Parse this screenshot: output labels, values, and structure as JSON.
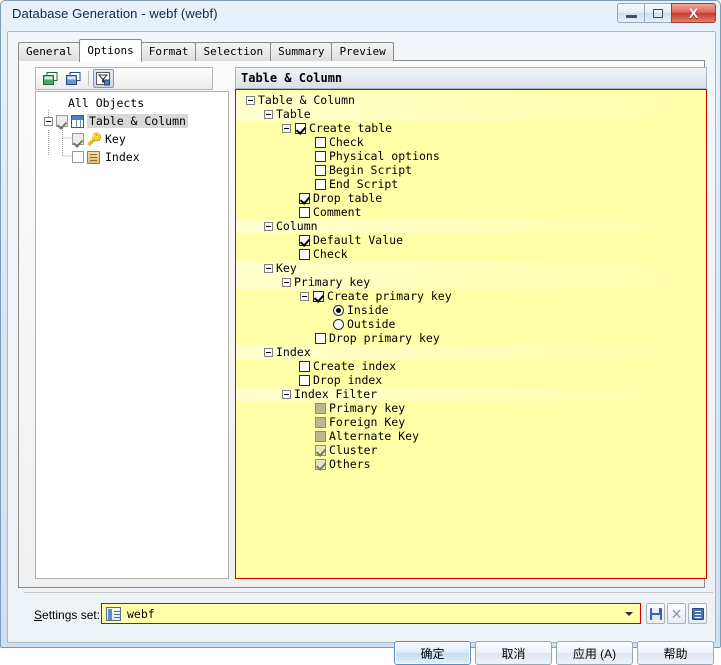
{
  "window": {
    "title": "Database Generation - webf (webf)",
    "controls": {
      "minimize": "Minimize",
      "maximize": "Maximize",
      "close": "X"
    }
  },
  "tabs": [
    {
      "label": "General",
      "active": false
    },
    {
      "label": "Options",
      "active": true
    },
    {
      "label": "Format",
      "active": false
    },
    {
      "label": "Selection",
      "active": false
    },
    {
      "label": "Summary",
      "active": false
    },
    {
      "label": "Preview",
      "active": false
    }
  ],
  "left_panel": {
    "toolbar": {
      "expand_all": "expand-all",
      "collapse_all": "collapse-all",
      "filter": "filter-selection"
    },
    "root_label": "All Objects",
    "items": [
      {
        "label": "Table & Column",
        "checked": true,
        "selected": true,
        "icon": "table-icon",
        "level": 0
      },
      {
        "label": "Key",
        "checked": true,
        "selected": false,
        "icon": "key-icon",
        "level": 1
      },
      {
        "label": "Index",
        "checked": false,
        "selected": false,
        "icon": "index-icon",
        "level": 1
      }
    ]
  },
  "right_panel": {
    "header": "Table & Column",
    "nodes": [
      {
        "label": "Table & Column",
        "indent": 0,
        "control": "expander",
        "expanded": true,
        "group": true
      },
      {
        "label": "Table",
        "indent": 1,
        "control": "expander",
        "expanded": true,
        "group": true
      },
      {
        "label": "Create table",
        "indent": 2,
        "control": "checkbox-expander",
        "expanded": true,
        "checked": true
      },
      {
        "label": "Check",
        "indent": 4,
        "control": "checkbox",
        "checked": false
      },
      {
        "label": "Physical options",
        "indent": 4,
        "control": "checkbox",
        "checked": false
      },
      {
        "label": "Begin Script",
        "indent": 4,
        "control": "checkbox",
        "checked": false
      },
      {
        "label": "End Script",
        "indent": 4,
        "control": "checkbox",
        "checked": false
      },
      {
        "label": "Drop table",
        "indent": 3,
        "control": "checkbox",
        "checked": true
      },
      {
        "label": "Comment",
        "indent": 3,
        "control": "checkbox",
        "checked": false
      },
      {
        "label": "Column",
        "indent": 1,
        "control": "expander",
        "expanded": true,
        "group": true
      },
      {
        "label": "Default Value",
        "indent": 3,
        "control": "checkbox",
        "checked": true
      },
      {
        "label": "Check",
        "indent": 3,
        "control": "checkbox",
        "checked": false
      },
      {
        "label": "Key",
        "indent": 1,
        "control": "expander",
        "expanded": true,
        "group": true
      },
      {
        "label": "Primary key",
        "indent": 2,
        "control": "expander",
        "expanded": true,
        "group": true
      },
      {
        "label": "Create primary key",
        "indent": 3,
        "control": "checkbox-expander",
        "expanded": true,
        "checked": true
      },
      {
        "label": "Inside",
        "indent": 5,
        "control": "radio",
        "selected": true
      },
      {
        "label": "Outside",
        "indent": 5,
        "control": "radio",
        "selected": false
      },
      {
        "label": "Drop primary key",
        "indent": 4,
        "control": "checkbox",
        "checked": false
      },
      {
        "label": "Index",
        "indent": 1,
        "control": "expander",
        "expanded": true,
        "group": true
      },
      {
        "label": "Create index",
        "indent": 3,
        "control": "checkbox",
        "checked": false
      },
      {
        "label": "Drop index",
        "indent": 3,
        "control": "checkbox",
        "checked": false
      },
      {
        "label": "Index Filter",
        "indent": 2,
        "control": "expander",
        "expanded": true,
        "group": true
      },
      {
        "label": "Primary key",
        "indent": 4,
        "control": "checkbox",
        "checked": false,
        "disabled": true
      },
      {
        "label": "Foreign Key",
        "indent": 4,
        "control": "checkbox",
        "checked": false,
        "disabled": true
      },
      {
        "label": "Alternate Key",
        "indent": 4,
        "control": "checkbox",
        "checked": false,
        "disabled": true
      },
      {
        "label": "Cluster",
        "indent": 4,
        "control": "checkbox",
        "checked": true,
        "disabled": true
      },
      {
        "label": "Others",
        "indent": 4,
        "control": "checkbox",
        "checked": true,
        "disabled": true
      }
    ]
  },
  "settings_set": {
    "label_prefix": "S",
    "label_rest": "ettings set:",
    "value": "webf",
    "save_button": "save-settings",
    "delete_button": "delete-settings",
    "properties_button": "settings-properties"
  },
  "buttons": [
    {
      "label": "确定",
      "name": "ok-button",
      "default": true
    },
    {
      "label": "取消",
      "name": "cancel-button",
      "default": false
    },
    {
      "label": "应用 (A)",
      "name": "apply-button",
      "default": false
    },
    {
      "label": "帮助",
      "name": "help-button",
      "default": false
    }
  ],
  "colors": {
    "panel_bg": "#ffffa8",
    "panel_border": "#d00000",
    "accent": "#3b61a6"
  }
}
